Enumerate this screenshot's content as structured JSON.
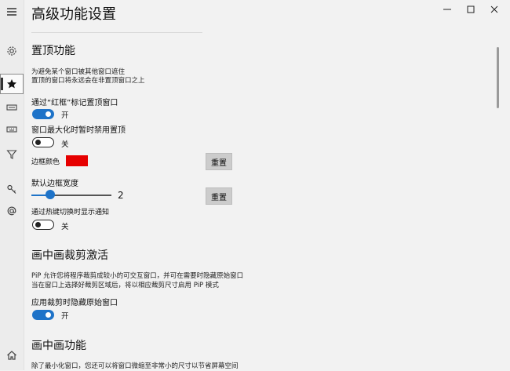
{
  "window": {
    "title": "高级功能设置"
  },
  "nav": {
    "items": [
      "menu-icon",
      "settings-icon",
      "star-icon",
      "keyboard-icon",
      "keyboard-alt-icon",
      "filter-icon",
      "key-icon",
      "at-icon",
      "home-icon"
    ],
    "active": "star-icon"
  },
  "topmost": {
    "heading": "置顶功能",
    "desc_line1": "为避免某个窗口被其他窗口遮住",
    "desc_line2": "置顶的窗口将永远会在非置顶窗口之上",
    "red_frame_label": "通过“红框”标记置顶窗口",
    "red_frame_state": "开",
    "maximize_label": "窗口最大化时暂时禁用置顶",
    "maximize_state": "关",
    "border_color_label": "边框颜色",
    "border_color": "#e60000",
    "reset_label": "重置",
    "border_width_label": "默认边框宽度",
    "border_width_value": "2",
    "border_width_level": 0.17,
    "hotkey_notify_label": "通过热键切换时显示通知",
    "hotkey_notify_state": "关"
  },
  "crop": {
    "heading": "画中画裁剪激活",
    "desc_line1": "PiP 允许您将程序裁剪成较小的可交互窗口，并可在需要时隐藏原始窗口",
    "desc_line2": "当在窗口上选择好裁剪区域后，将以相应裁剪尺寸启用 PiP 模式",
    "hide_original_label": "应用裁剪时隐藏原始窗口",
    "hide_original_state": "开"
  },
  "pip": {
    "heading": "画中画功能",
    "desc_line1": "除了最小化窗口，您还可以将窗口微缩至非常小的尺寸以节省屏幕空间"
  },
  "colors": {
    "accent": "#1e73c8",
    "background": "#f2f2f2"
  }
}
